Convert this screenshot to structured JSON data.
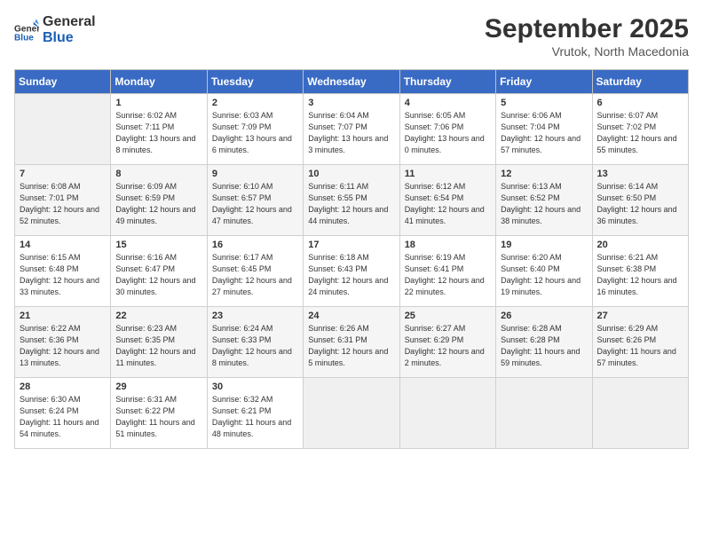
{
  "header": {
    "logo_line1": "General",
    "logo_line2": "Blue",
    "month": "September 2025",
    "location": "Vrutok, North Macedonia"
  },
  "days_of_week": [
    "Sunday",
    "Monday",
    "Tuesday",
    "Wednesday",
    "Thursday",
    "Friday",
    "Saturday"
  ],
  "weeks": [
    [
      {
        "day": "",
        "empty": true
      },
      {
        "day": "1",
        "sunrise": "6:02 AM",
        "sunset": "7:11 PM",
        "daylight": "13 hours and 8 minutes."
      },
      {
        "day": "2",
        "sunrise": "6:03 AM",
        "sunset": "7:09 PM",
        "daylight": "13 hours and 6 minutes."
      },
      {
        "day": "3",
        "sunrise": "6:04 AM",
        "sunset": "7:07 PM",
        "daylight": "13 hours and 3 minutes."
      },
      {
        "day": "4",
        "sunrise": "6:05 AM",
        "sunset": "7:06 PM",
        "daylight": "13 hours and 0 minutes."
      },
      {
        "day": "5",
        "sunrise": "6:06 AM",
        "sunset": "7:04 PM",
        "daylight": "12 hours and 57 minutes."
      },
      {
        "day": "6",
        "sunrise": "6:07 AM",
        "sunset": "7:02 PM",
        "daylight": "12 hours and 55 minutes."
      }
    ],
    [
      {
        "day": "7",
        "sunrise": "6:08 AM",
        "sunset": "7:01 PM",
        "daylight": "12 hours and 52 minutes."
      },
      {
        "day": "8",
        "sunrise": "6:09 AM",
        "sunset": "6:59 PM",
        "daylight": "12 hours and 49 minutes."
      },
      {
        "day": "9",
        "sunrise": "6:10 AM",
        "sunset": "6:57 PM",
        "daylight": "12 hours and 47 minutes."
      },
      {
        "day": "10",
        "sunrise": "6:11 AM",
        "sunset": "6:55 PM",
        "daylight": "12 hours and 44 minutes."
      },
      {
        "day": "11",
        "sunrise": "6:12 AM",
        "sunset": "6:54 PM",
        "daylight": "12 hours and 41 minutes."
      },
      {
        "day": "12",
        "sunrise": "6:13 AM",
        "sunset": "6:52 PM",
        "daylight": "12 hours and 38 minutes."
      },
      {
        "day": "13",
        "sunrise": "6:14 AM",
        "sunset": "6:50 PM",
        "daylight": "12 hours and 36 minutes."
      }
    ],
    [
      {
        "day": "14",
        "sunrise": "6:15 AM",
        "sunset": "6:48 PM",
        "daylight": "12 hours and 33 minutes."
      },
      {
        "day": "15",
        "sunrise": "6:16 AM",
        "sunset": "6:47 PM",
        "daylight": "12 hours and 30 minutes."
      },
      {
        "day": "16",
        "sunrise": "6:17 AM",
        "sunset": "6:45 PM",
        "daylight": "12 hours and 27 minutes."
      },
      {
        "day": "17",
        "sunrise": "6:18 AM",
        "sunset": "6:43 PM",
        "daylight": "12 hours and 24 minutes."
      },
      {
        "day": "18",
        "sunrise": "6:19 AM",
        "sunset": "6:41 PM",
        "daylight": "12 hours and 22 minutes."
      },
      {
        "day": "19",
        "sunrise": "6:20 AM",
        "sunset": "6:40 PM",
        "daylight": "12 hours and 19 minutes."
      },
      {
        "day": "20",
        "sunrise": "6:21 AM",
        "sunset": "6:38 PM",
        "daylight": "12 hours and 16 minutes."
      }
    ],
    [
      {
        "day": "21",
        "sunrise": "6:22 AM",
        "sunset": "6:36 PM",
        "daylight": "12 hours and 13 minutes."
      },
      {
        "day": "22",
        "sunrise": "6:23 AM",
        "sunset": "6:35 PM",
        "daylight": "12 hours and 11 minutes."
      },
      {
        "day": "23",
        "sunrise": "6:24 AM",
        "sunset": "6:33 PM",
        "daylight": "12 hours and 8 minutes."
      },
      {
        "day": "24",
        "sunrise": "6:26 AM",
        "sunset": "6:31 PM",
        "daylight": "12 hours and 5 minutes."
      },
      {
        "day": "25",
        "sunrise": "6:27 AM",
        "sunset": "6:29 PM",
        "daylight": "12 hours and 2 minutes."
      },
      {
        "day": "26",
        "sunrise": "6:28 AM",
        "sunset": "6:28 PM",
        "daylight": "11 hours and 59 minutes."
      },
      {
        "day": "27",
        "sunrise": "6:29 AM",
        "sunset": "6:26 PM",
        "daylight": "11 hours and 57 minutes."
      }
    ],
    [
      {
        "day": "28",
        "sunrise": "6:30 AM",
        "sunset": "6:24 PM",
        "daylight": "11 hours and 54 minutes."
      },
      {
        "day": "29",
        "sunrise": "6:31 AM",
        "sunset": "6:22 PM",
        "daylight": "11 hours and 51 minutes."
      },
      {
        "day": "30",
        "sunrise": "6:32 AM",
        "sunset": "6:21 PM",
        "daylight": "11 hours and 48 minutes."
      },
      {
        "day": "",
        "empty": true
      },
      {
        "day": "",
        "empty": true
      },
      {
        "day": "",
        "empty": true
      },
      {
        "day": "",
        "empty": true
      }
    ]
  ],
  "labels": {
    "sunrise_label": "Sunrise:",
    "sunset_label": "Sunset:",
    "daylight_label": "Daylight:"
  }
}
